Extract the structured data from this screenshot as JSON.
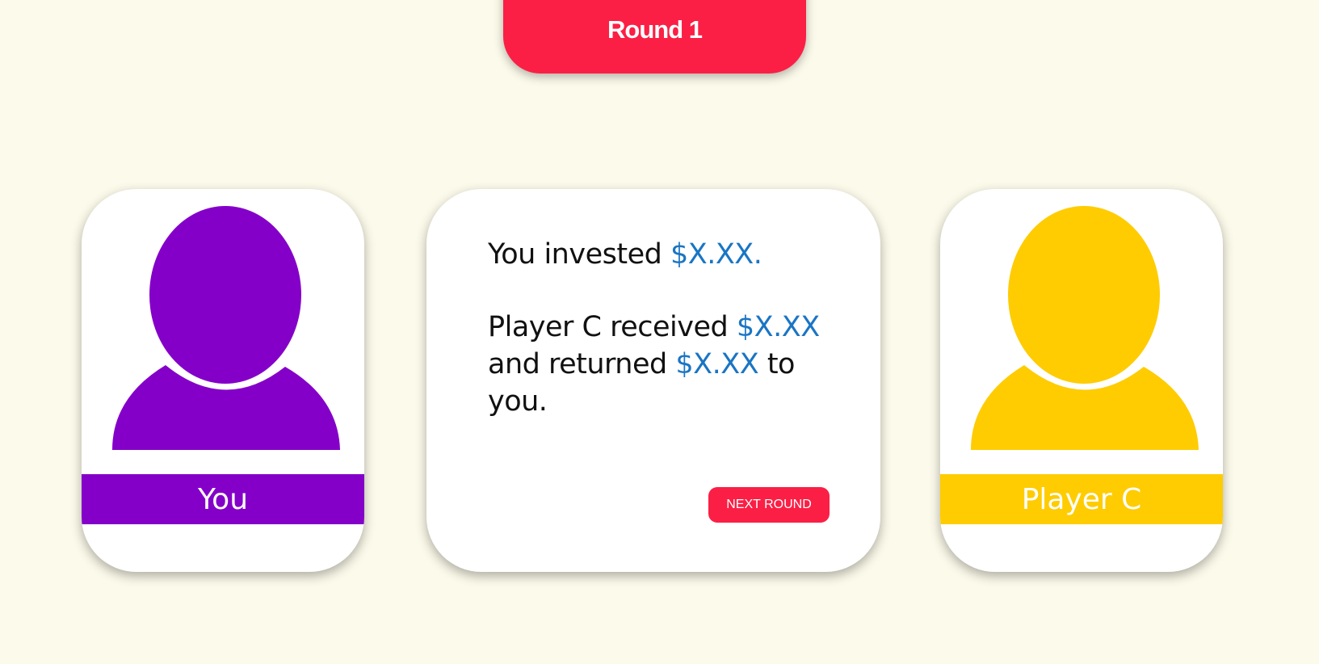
{
  "header": {
    "round_label": "Round 1"
  },
  "players": {
    "you": {
      "name": "You",
      "color": "#8400c9",
      "icon": "person-avatar-icon"
    },
    "other": {
      "name": "Player C",
      "color": "#fecc00",
      "icon": "person-avatar-icon"
    }
  },
  "message": {
    "invested_prefix": "You invested ",
    "invested_amount": "$X.XX.",
    "received_prefix": "Player C received ",
    "received_amount": "$X.XX",
    "returned_prefix": " and returned ",
    "returned_amount": "$X.XX",
    "returned_suffix": " to you."
  },
  "actions": {
    "next_label": "NEXT ROUND"
  },
  "colors": {
    "background": "#fcfaea",
    "accent": "#fb1f45",
    "amount": "#1a75c4"
  }
}
